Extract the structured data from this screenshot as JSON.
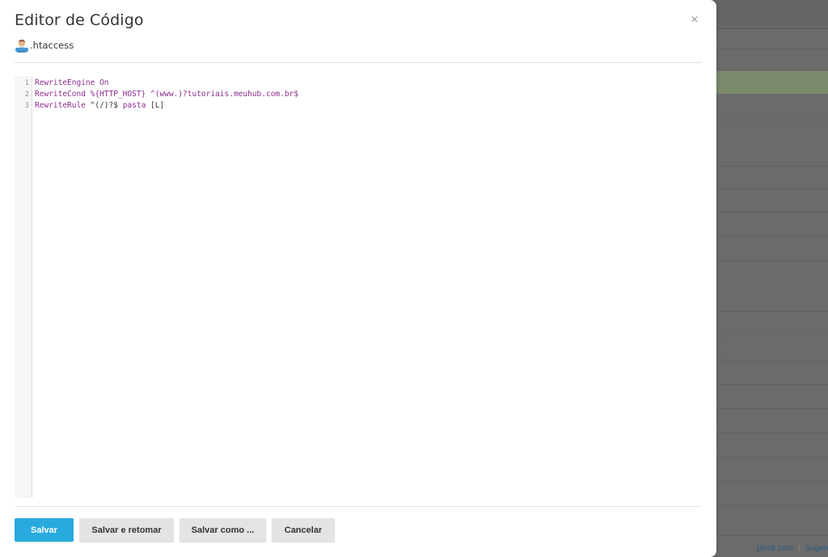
{
  "modal": {
    "title": "Editor de Código",
    "close_symbol": "×",
    "file_icon": "user-icon",
    "file_name": ".htaccess"
  },
  "editor": {
    "lines": [
      {
        "number": "1",
        "tokens": [
          {
            "text": "RewriteEngine On",
            "kind": "keyword"
          }
        ]
      },
      {
        "number": "2",
        "tokens": [
          {
            "text": "RewriteCond %{HTTP_HOST}",
            "kind": "keyword"
          },
          {
            "text": " ^(www.)?tutoriais.meuhub.com.br$",
            "kind": "keyword"
          }
        ]
      },
      {
        "number": "3",
        "tokens": [
          {
            "text": "RewriteRule",
            "kind": "keyword"
          },
          {
            "text": " ^(/)?$ ",
            "kind": "plain"
          },
          {
            "text": "pasta",
            "kind": "keyword"
          },
          {
            "text": " [L]",
            "kind": "plain"
          }
        ]
      }
    ],
    "colors": {
      "keyword": "#8b2c8e",
      "plain": "#333333"
    }
  },
  "buttons": {
    "save": "Salvar",
    "save_return": "Salvar e retomar",
    "save_as": "Salvar como ...",
    "cancel": "Cancelar"
  },
  "background": {
    "footer_link1": "plesk.com",
    "footer_link2": "Sugerir"
  },
  "colors": {
    "primary": "#28aade",
    "overlay": "#6b6b6b"
  }
}
